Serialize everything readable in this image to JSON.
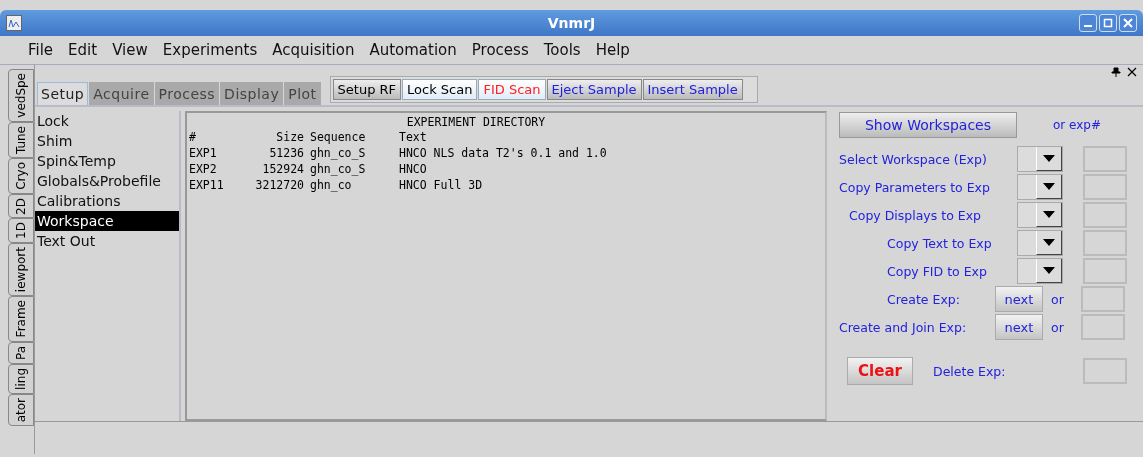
{
  "window": {
    "title": "VnmrJ"
  },
  "menu": [
    "File",
    "Edit",
    "View",
    "Experiments",
    "Acquisition",
    "Automation",
    "Process",
    "Tools",
    "Help"
  ],
  "side_tabs": [
    "vedSpe",
    "Tune",
    "Cryo",
    "2D",
    "1D",
    "iewport",
    "Frame",
    "Pa",
    "ling",
    "ator"
  ],
  "tabs": [
    {
      "label": "Setup",
      "selected": true
    },
    {
      "label": "Acquire",
      "selected": false
    },
    {
      "label": "Process",
      "selected": false
    },
    {
      "label": "Display",
      "selected": false
    },
    {
      "label": "Plot",
      "selected": false
    }
  ],
  "toolbar": [
    {
      "label": "Setup RF",
      "color": "#000000",
      "highlighted": false
    },
    {
      "label": "Lock Scan",
      "color": "#000000",
      "highlighted": true
    },
    {
      "label": "FID Scan",
      "color": "#ff2020",
      "highlighted": true
    },
    {
      "label": "Eject Sample",
      "color": "#2020e0",
      "highlighted": false
    },
    {
      "label": "Insert Sample",
      "color": "#2020e0",
      "highlighted": false
    }
  ],
  "panel_items": [
    {
      "label": "Lock",
      "selected": false
    },
    {
      "label": "Shim",
      "selected": false
    },
    {
      "label": "Spin&Temp",
      "selected": false
    },
    {
      "label": "Globals&Probefile",
      "selected": false
    },
    {
      "label": "Calibrations",
      "selected": false
    },
    {
      "label": "Workspace",
      "selected": true
    },
    {
      "label": "Text Out",
      "selected": false
    }
  ],
  "directory": {
    "title": "EXPERIMENT DIRECTORY",
    "columns": [
      "#",
      "Size",
      "Sequence",
      "Text"
    ],
    "rows": [
      [
        "EXP1",
        "51236",
        "ghn_co_S",
        "HNCO NLS data T2's 0.1 and 1.0"
      ],
      [
        "EXP2",
        "152924",
        "ghn_co_S",
        "HNCO"
      ],
      [
        "EXP11",
        "3212720",
        "ghn_co",
        "HNCO Full 3D"
      ]
    ]
  },
  "workspace": {
    "show_button": "Show Workspaces",
    "or_label": "or exp#",
    "rows": [
      {
        "kind": "dropdown",
        "label": "Select Workspace (Exp)"
      },
      {
        "kind": "dropdown",
        "label": "Copy Parameters to Exp"
      },
      {
        "kind": "dropdown",
        "label": "Copy Displays to Exp"
      },
      {
        "kind": "dropdown",
        "label": "Copy Text to Exp"
      },
      {
        "kind": "dropdown",
        "label": "Copy FID to Exp"
      },
      {
        "kind": "next",
        "label": "Create Exp:",
        "button": "next",
        "or": "or"
      },
      {
        "kind": "next",
        "label": "Create and Join Exp:",
        "button": "next",
        "or": "or"
      },
      {
        "kind": "clear",
        "label": "Delete Exp:",
        "button": "Clear"
      }
    ]
  }
}
